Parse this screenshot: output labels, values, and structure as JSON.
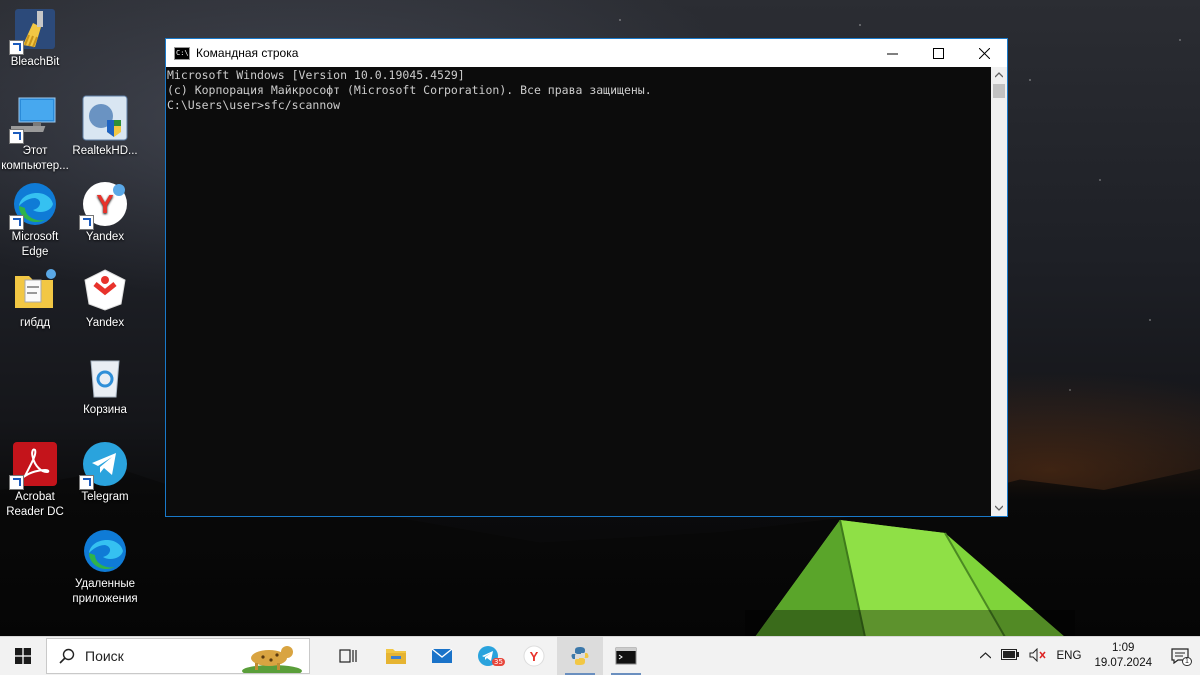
{
  "desktop": {
    "icons": [
      {
        "label": "BleachBit"
      },
      {
        "label": "Этот компьютер..."
      },
      {
        "label": "RealtekHD..."
      },
      {
        "label": "Microsoft Edge"
      },
      {
        "label": "Yandex"
      },
      {
        "label": "гибдд"
      },
      {
        "label": "Yandex"
      },
      {
        "label": "Корзина"
      },
      {
        "label": "Acrobat Reader DC"
      },
      {
        "label": "Telegram"
      },
      {
        "label": "Удаленные приложения"
      }
    ]
  },
  "window": {
    "title": "Командная строка",
    "icon_text": "C:\\.",
    "console_lines": [
      "Microsoft Windows [Version 10.0.19045.4529]",
      "(c) Корпорация Майкрософт (Microsoft Corporation). Все права защищены.",
      "",
      "C:\\Users\\user>sfc/scannow"
    ]
  },
  "taskbar": {
    "search_placeholder": "Поиск",
    "telegram_badge": "35",
    "language": "ENG",
    "time": "1:09",
    "date": "19.07.2024",
    "notification_count": "1"
  },
  "colors": {
    "accent": "#1979c9",
    "console_bg": "#0c0c0c",
    "console_text": "#cccccc",
    "taskbar_bg": "#f2f2f2"
  }
}
